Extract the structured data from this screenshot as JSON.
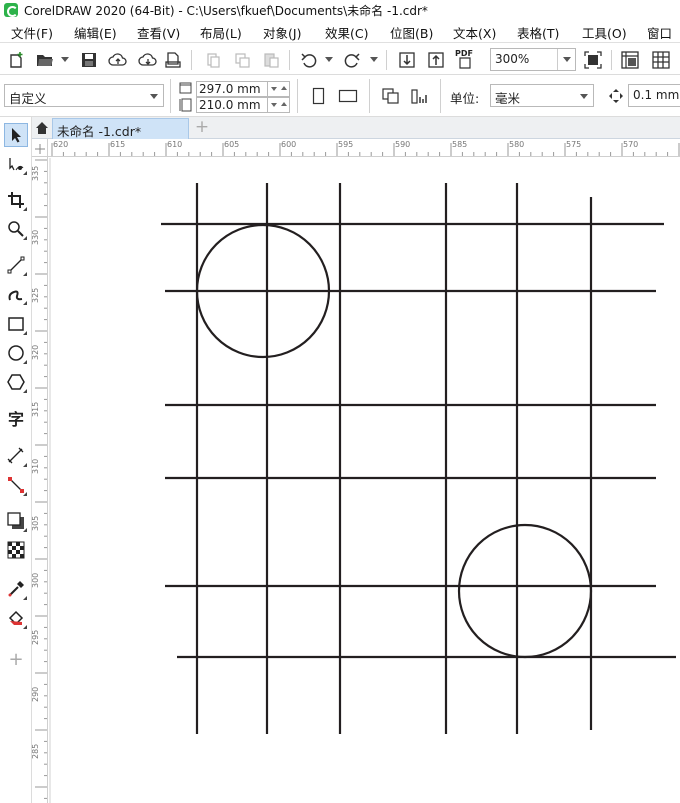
{
  "window": {
    "title": "CorelDRAW 2020 (64-Bit) - C:\\Users\\fkuef\\Documents\\未命名 -1.cdr*"
  },
  "menu": {
    "items": [
      "文件(F)",
      "编辑(E)",
      "查看(V)",
      "布局(L)",
      "对象(J)",
      "效果(C)",
      "位图(B)",
      "文本(X)",
      "表格(T)",
      "工具(O)",
      "窗口"
    ]
  },
  "toolbar": {
    "zoom_value": "300%",
    "pdf_label": "PDF"
  },
  "propbar": {
    "paper_preset": "自定义",
    "width": "297.0 mm",
    "height": "210.0 mm",
    "unit_label": "单位:",
    "unit_value": "毫米",
    "nudge": "0.1 mm"
  },
  "document": {
    "tab_label": "未命名 -1.cdr*",
    "add_tab": "+"
  },
  "rulers": {
    "horizontal": [
      "620",
      "615",
      "610",
      "605",
      "600",
      "595",
      "590",
      "585",
      "580",
      "575",
      "570"
    ],
    "vertical": [
      "335",
      "330",
      "325",
      "320",
      "315",
      "310",
      "305",
      "300",
      "295",
      "290",
      "285"
    ]
  },
  "toolbox": {
    "text_tool_glyph": "字",
    "add_tool_glyph": "+"
  },
  "colors": {
    "accent": "#cfe3f7",
    "stroke": "#231f20"
  }
}
